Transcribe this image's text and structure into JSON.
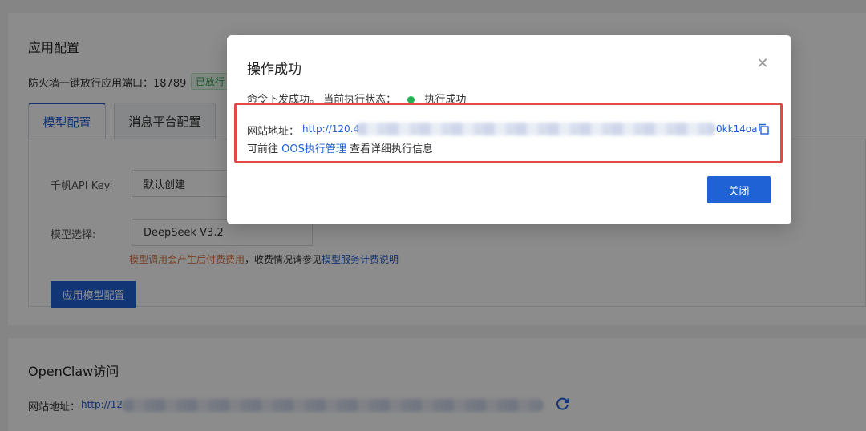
{
  "config": {
    "title": "应用配置",
    "firewall_label": "防火墙一键放行应用端口：18789",
    "firewall_badge": "已放行",
    "tabs": [
      {
        "label": "模型配置"
      },
      {
        "label": "消息平台配置"
      }
    ],
    "api_key_label": "千帆API Key:",
    "api_key_value": "默认创建",
    "model_label": "模型选择:",
    "model_value": "DeepSeek V3.2",
    "hint_warn": "模型调用会产生后付费费用",
    "hint_mid": "，收费情况请参见",
    "hint_link": "模型服务计费说明",
    "apply_button": "应用模型配置"
  },
  "access": {
    "title": "OpenClaw访问",
    "url_label": "网站地址：",
    "url_prefix": "http://12"
  },
  "modal": {
    "title": "操作成功",
    "status_text": "命令下发成功。 当前执行状态：",
    "status_value": "执行成功",
    "url_label": "网站地址：",
    "url_prefix": "http://120.4",
    "url_suffix": "0kk14oa",
    "oos_prefix": "可前往 ",
    "oos_link": "OOS执行管理",
    "oos_suffix": " 查看详细执行信息",
    "close_button": "关闭"
  },
  "colors": {
    "primary": "#1f62d6",
    "success": "#22b455",
    "highlight_frame": "#e24a4a"
  },
  "icons": {
    "close": "close-icon",
    "copy": "copy-icon",
    "refresh": "refresh-icon"
  }
}
